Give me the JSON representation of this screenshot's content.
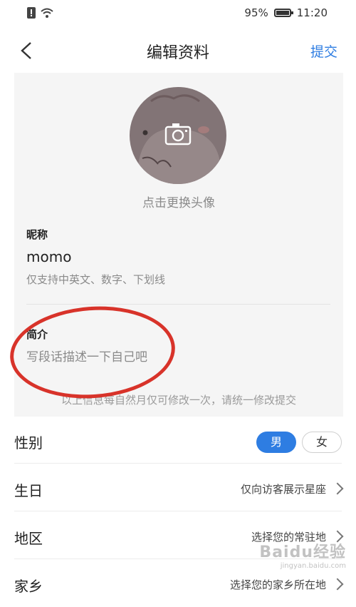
{
  "status_bar": {
    "battery": "95%",
    "time": "11:20"
  },
  "header": {
    "title": "编辑资料",
    "submit_label": "提交"
  },
  "profile": {
    "avatar_hint": "点击更换头像",
    "nickname_label": "昵称",
    "nickname_value": "momo",
    "nickname_hint": "仅支持中英文、数字、下划线",
    "bio_label": "简介",
    "bio_placeholder": "写段话描述一下自己吧",
    "notice": "以上信息每自然月仅可修改一次，请统一修改提交"
  },
  "rows": {
    "gender": {
      "label": "性别",
      "options": [
        "男",
        "女"
      ],
      "selected": "男"
    },
    "birthday": {
      "label": "生日",
      "value": "仅向访客展示星座"
    },
    "region": {
      "label": "地区",
      "value": "选择您的常驻地"
    },
    "hometown": {
      "label": "家乡",
      "value": "选择您的家乡所在地"
    }
  },
  "watermark": {
    "text": "Baidu经验",
    "sub": "jingyan.baidu.com"
  },
  "colors": {
    "accent": "#2e7de2",
    "annotation": "#d8332a",
    "panel_bg": "#f5f5f5"
  }
}
